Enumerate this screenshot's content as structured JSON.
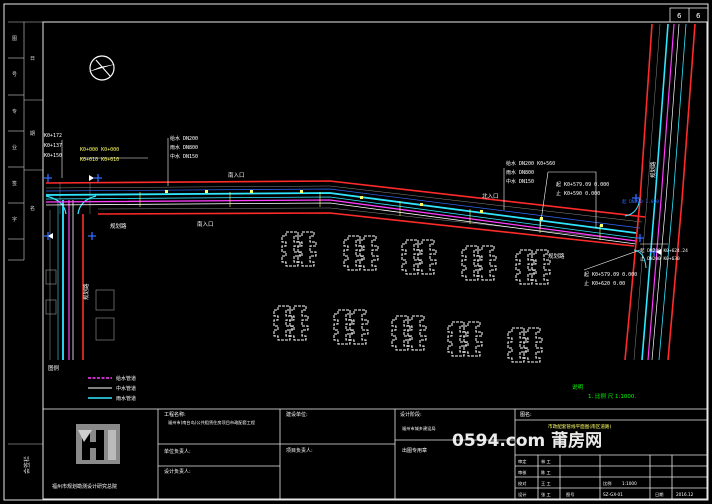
{
  "sheet": {
    "tag_a": "6",
    "tag_b": "6"
  },
  "colors": {
    "background": "#000000",
    "frame": "#e8e8e8",
    "road_edge": "#ff2a2a",
    "water_supply": "#ff3cff",
    "reclaimed_water": "#ffffff",
    "rain_water": "#30e6ff",
    "building": "#ffffff",
    "note_green": "#00ff00",
    "text_yellow": "#ffff66"
  },
  "labels": {
    "left_chainage": [
      "K0+172",
      "K0+137",
      "K0+150"
    ],
    "left_chainage_sub": [
      "K0+000 K0+000",
      "K0+010 K0+010"
    ],
    "pipe_note_left_top": [
      "给水 DN200",
      "雨水 DN800",
      "中水 DN150"
    ],
    "north_gate": "南入口",
    "mid_gate": "南入口",
    "road_left": "规划路",
    "road_vertical": "规划路",
    "road_mid": "规划路",
    "right_cross": "规划路",
    "right_gate": "北入口",
    "right_note_top": [
      "给水 DN200 K0+560",
      "雨水 DN800",
      "中水 DN150"
    ],
    "right_note_mid": [
      "起 K0+579.09 0.000",
      "止 K0+590 0.000"
    ],
    "right_note_low": [
      "起 K0+579.09 0.000",
      "止 K0+620 0.00"
    ],
    "right_end": [
      "起 DN200 K0+624.24",
      "止 DN200 K0+630"
    ],
    "right_low_text": [
      "起 DN200 1.000",
      "止 DN200 1.000"
    ]
  },
  "legend": {
    "title": "图例",
    "items": [
      {
        "label": "给水管道",
        "color": "#ff3cff"
      },
      {
        "label": "中水管道",
        "color": "#ffffff"
      },
      {
        "label": "雨水管道",
        "color": "#30e6ff"
      }
    ]
  },
  "note": {
    "title": "说明",
    "text": "1. 比例 尺 1:1000."
  },
  "title_block": {
    "company": "福州市规划勘测设计研究总院",
    "project_label": "工程名称:",
    "project_name": "福州市(南台岛)公共租赁住房项目市政配套工程",
    "drawing_label": "图名:",
    "drawing_name": "市政配套管线平面图(南区道路)",
    "owner_label": "建设单位:",
    "owner_name": "福州市城乡建设局",
    "design_label": "设计阶段:",
    "design_stage": "施工图设计",
    "stamp_label": "出图专用章",
    "row_labels": [
      "审定",
      "审核",
      "校对",
      "设计"
    ],
    "row_values": [
      "林 工",
      "陈 工",
      "王 工",
      "张 工"
    ],
    "scale_label": "比例",
    "scale_value": "1:1000",
    "drawing_no_label": "图号",
    "drawing_no": "SZ-GX-01",
    "date_label": "日期",
    "date_value": "2016.12",
    "side_label": "会签栏",
    "small_left_1": "单位负责人:",
    "small_left_2": "设计负责人:",
    "small_left_3": "项目负责人:"
  },
  "watermark": "0594.com 莆房网"
}
